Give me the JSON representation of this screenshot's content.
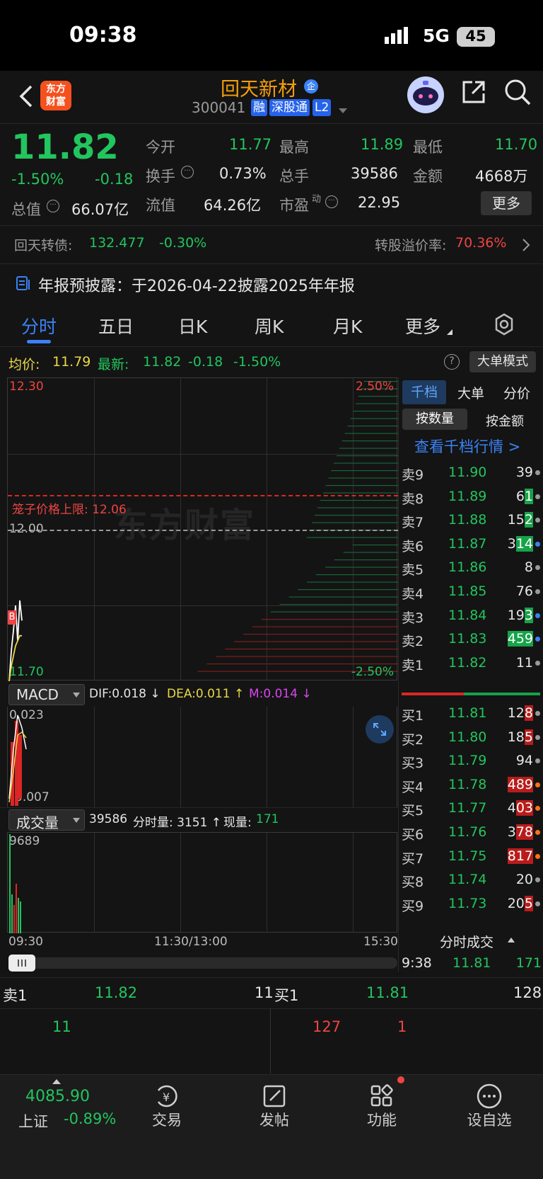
{
  "status_bar": {
    "time": "09:38",
    "network": "5G",
    "battery": "45"
  },
  "header": {
    "logo_line1": "东方",
    "logo_line2": "财富",
    "stock_name": "回天新材",
    "badge": "企",
    "stock_code": "300041",
    "tags": [
      "融",
      "深股通",
      "L2"
    ]
  },
  "quote": {
    "price": "11.82",
    "change_pct": "-1.50%",
    "change_abs": "-0.18",
    "open_label": "今开",
    "open_value": "11.77",
    "high_label": "最高",
    "high_value": "11.89",
    "low_label": "最低",
    "low_value": "11.70",
    "turnover_label": "换手",
    "turnover_value": "0.73%",
    "volume_label": "总手",
    "volume_value": "39586",
    "amount_label": "金额",
    "amount_value": "4668万",
    "mktcap_label": "总值",
    "mktcap_value": "66.07亿",
    "float_label": "流值",
    "float_value": "64.26亿",
    "pe_label": "市盈",
    "pe_sup": "动",
    "pe_value": "22.95",
    "more_button": "更多"
  },
  "bond": {
    "label": "回天转债:",
    "price": "132.477",
    "change": "-0.30%",
    "premium_label": "转股溢价率:",
    "premium_value": "70.36%"
  },
  "notice": {
    "text": "年报预披露：于2026-04-22披露2025年年报"
  },
  "tabs": [
    {
      "label": "分时",
      "active": true
    },
    {
      "label": "五日"
    },
    {
      "label": "日K"
    },
    {
      "label": "周K"
    },
    {
      "label": "月K"
    },
    {
      "label": "更多"
    }
  ],
  "intraday": {
    "avg_label": "均价:",
    "avg_value": "11.79",
    "latest_label": "最新:",
    "latest_value": "11.82",
    "latest_change": "-0.18",
    "latest_pct": "-1.50%",
    "mode_button": "大单模式",
    "y_high": "12.30",
    "y_low": "11.70",
    "y_mid": "12.00",
    "pct_high": "2.50%",
    "pct_low": "-2.50%",
    "limit_label": "笼子价格上限: 12.06",
    "watermark": "东方财富",
    "marker": "B",
    "price_series": [
      11.7,
      11.76,
      11.8,
      11.85,
      11.78,
      11.86,
      11.82
    ],
    "avg_series": [
      11.7,
      11.73,
      11.75,
      11.77,
      11.78,
      11.79,
      11.79
    ]
  },
  "macd": {
    "selector": "MACD",
    "dif": "DIF:0.018 ↓",
    "dea": "DEA:0.011 ↑",
    "m": "M:0.014 ↓",
    "y_top": "0.023",
    "y_bottom": "0.007"
  },
  "volume": {
    "selector": "成交量",
    "total": "39586",
    "min_label": "分时量: 3151 ↑",
    "now_label": "现量:",
    "now_value": "171",
    "y_top": "9689",
    "x_start": "09:30",
    "x_mid": "11:30/13:00",
    "x_end": "15:30"
  },
  "orderbook": {
    "tabs": [
      "千档",
      "大单",
      "分价"
    ],
    "mode_tabs": [
      "按数量",
      "按金额"
    ],
    "link": "查看千档行情 >",
    "asks": [
      {
        "label": "卖9",
        "price": "11.90",
        "qty": "39",
        "hl": "",
        "hl_color": "",
        "dot": "#9a9a9a"
      },
      {
        "label": "卖8",
        "price": "11.89",
        "qty": "6",
        "hl": "1",
        "hl_color": "#16a34a",
        "dot": "#9a9a9a"
      },
      {
        "label": "卖7",
        "price": "11.88",
        "qty": "15",
        "hl": "2",
        "hl_color": "#16a34a",
        "dot": "#9a9a9a"
      },
      {
        "label": "卖6",
        "price": "11.87",
        "qty": "3",
        "hl": "14",
        "hl_color": "#16a34a",
        "dot": "#3b82f6"
      },
      {
        "label": "卖5",
        "price": "11.86",
        "qty": "8",
        "hl": "",
        "hl_color": "",
        "dot": "#9a9a9a"
      },
      {
        "label": "卖4",
        "price": "11.85",
        "qty": "76",
        "hl": "",
        "hl_color": "",
        "dot": "#9a9a9a"
      },
      {
        "label": "卖3",
        "price": "11.84",
        "qty": "19",
        "hl": "3",
        "hl_color": "#16a34a",
        "dot": "#3b82f6"
      },
      {
        "label": "卖2",
        "price": "11.83",
        "qty": "",
        "hl": "459",
        "hl_color": "#16a34a",
        "dot": "#3b82f6"
      },
      {
        "label": "卖1",
        "price": "11.82",
        "qty": "11",
        "hl": "",
        "hl_color": "",
        "dot": "#9a9a9a"
      }
    ],
    "bids": [
      {
        "label": "买1",
        "price": "11.81",
        "qty": "12",
        "hl": "8",
        "hl_color": "#b91c1c",
        "dot": "#9a9a9a"
      },
      {
        "label": "买2",
        "price": "11.80",
        "qty": "18",
        "hl": "5",
        "hl_color": "#b91c1c",
        "dot": "#9a9a9a"
      },
      {
        "label": "买3",
        "price": "11.79",
        "qty": "94",
        "hl": "",
        "hl_color": "",
        "dot": "#9a9a9a"
      },
      {
        "label": "买4",
        "price": "11.78",
        "qty": "",
        "hl": "489",
        "hl_color": "#b91c1c",
        "dot": "#f97316"
      },
      {
        "label": "买5",
        "price": "11.77",
        "qty": "4",
        "hl": "03",
        "hl_color": "#b91c1c",
        "dot": "#f97316"
      },
      {
        "label": "买6",
        "price": "11.76",
        "qty": "3",
        "hl": "78",
        "hl_color": "#b91c1c",
        "dot": "#f97316"
      },
      {
        "label": "买7",
        "price": "11.75",
        "qty": "",
        "hl": "817",
        "hl_color": "#b91c1c",
        "dot": "#f97316"
      },
      {
        "label": "买8",
        "price": "11.74",
        "qty": "20",
        "hl": "",
        "hl_color": "",
        "dot": "#9a9a9a"
      },
      {
        "label": "买9",
        "price": "11.73",
        "qty": "20",
        "hl": "5",
        "hl_color": "#b91c1c",
        "dot": "#9a9a9a"
      }
    ],
    "trades_header": "分时成交",
    "trade": {
      "time": "9:38",
      "price": "11.81",
      "qty": "171"
    }
  },
  "bottom_quote": {
    "sell_label": "卖1",
    "sell_price": "11.82",
    "sell_qty": "11",
    "buy_label": "买1",
    "buy_price": "11.81",
    "buy_qty": "128",
    "sell_detail": "11",
    "buy_detail_1": "127",
    "buy_detail_2": "1"
  },
  "bottom_nav": {
    "index_value": "4085.90",
    "index_name": "上证",
    "index_pct": "-0.89%",
    "items": [
      "交易",
      "发帖",
      "功能",
      "设自选"
    ]
  },
  "colors": {
    "up": "#ef4444",
    "down": "#22c55e",
    "accent": "#3b82f6",
    "background": "#141414"
  }
}
